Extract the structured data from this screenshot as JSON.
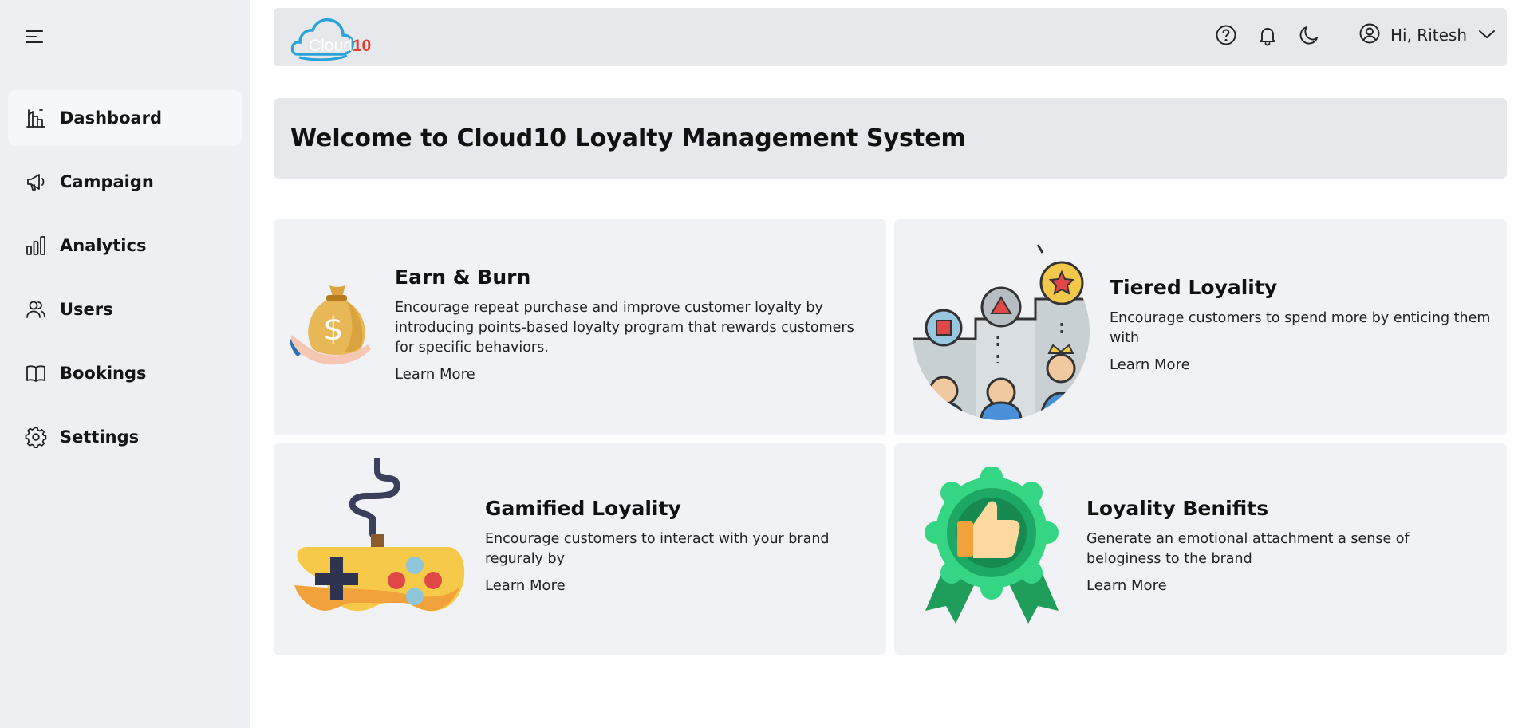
{
  "header": {
    "logo_text_part1": "Cloud",
    "logo_text_part2": "10",
    "icons": [
      "help-circle-icon",
      "bell-icon",
      "moon-icon",
      "user-circle-icon",
      "chevron-down-icon"
    ],
    "user_greeting": "Hi, Ritesh"
  },
  "sidebar": {
    "menu_icon": "hamburger-menu-icon",
    "items": [
      {
        "label": "Dashboard",
        "icon": "dashboard-icon",
        "active": true
      },
      {
        "label": "Campaign",
        "icon": "megaphone-icon",
        "active": false
      },
      {
        "label": "Analytics",
        "icon": "bar-chart-icon",
        "active": false
      },
      {
        "label": "Users",
        "icon": "users-icon",
        "active": false
      },
      {
        "label": "Bookings",
        "icon": "book-icon",
        "active": false
      },
      {
        "label": "Settings",
        "icon": "gear-icon",
        "active": false
      }
    ]
  },
  "main": {
    "welcome_title": "Welcome to Cloud10 Loyalty Management System",
    "cards": [
      {
        "title": "Earn & Burn",
        "description": "Encourage repeat purchase and improve customer loyalty by introducing points-based loyalty program that rewards customers for specific behaviors.",
        "link": "Learn More",
        "image": "money-bag-illustration"
      },
      {
        "title": "Tiered Loyality",
        "description": "Encourage customers to spend more by enticing them with",
        "link": "Learn More",
        "image": "tiered-podium-illustration"
      },
      {
        "title": "Gamified Loyality",
        "description": "Encourage customers to interact with your brand reguraly by",
        "link": "Learn More",
        "image": "gamepad-illustration"
      },
      {
        "title": "Loyality Benifits",
        "description": "Generate an emotional attachment a sense of beloginess to the brand",
        "link": "Learn More",
        "image": "thumbs-up-badge-illustration"
      }
    ]
  },
  "colors": {
    "sidebar_bg": "#edeff3",
    "active_item_bg": "#f6f7f9",
    "panel_bg": "#e7e8ec",
    "card_bg": "#f0f2f6",
    "logo_red": "#e53935",
    "logo_blue": "#2aa3d8"
  }
}
